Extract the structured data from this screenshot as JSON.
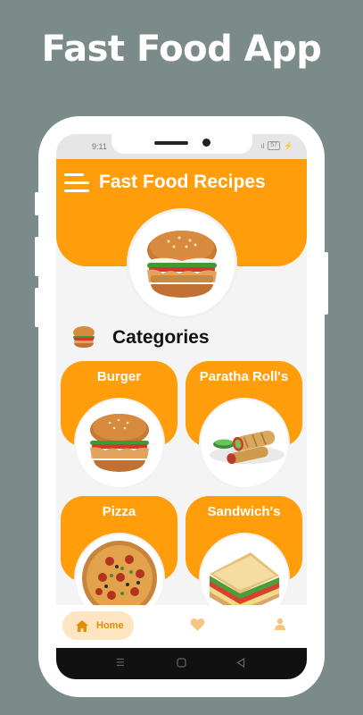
{
  "promo": {
    "headline": "Fast Food App"
  },
  "status_bar": {
    "time": "9:11",
    "signal": "ıl",
    "battery": "57"
  },
  "header": {
    "title": "Fast Food Recipes",
    "menu_icon": "hamburger-menu-icon"
  },
  "section": {
    "title": "Categories"
  },
  "categories": [
    {
      "label": "Burger",
      "image": "burger"
    },
    {
      "label": "Paratha Roll's",
      "image": "paratha-roll"
    },
    {
      "label": "Pizza",
      "image": "pizza"
    },
    {
      "label": "Sandwich's",
      "image": "sandwich"
    }
  ],
  "bottom_nav": {
    "items": [
      {
        "label": "Home",
        "icon": "home-icon",
        "active": true
      },
      {
        "label": "",
        "icon": "heart-icon",
        "active": false
      },
      {
        "label": "",
        "icon": "profile-icon",
        "active": false
      }
    ]
  },
  "system_nav": {
    "icons": [
      "recents-icon",
      "home-circle-icon",
      "back-triangle-icon"
    ]
  },
  "colors": {
    "background": "#7b8b8a",
    "accent": "#ff9d0b",
    "nav_active_bg": "#fde5c2",
    "nav_active_text": "#e58b05",
    "nav_icon": "#f7c57f"
  }
}
